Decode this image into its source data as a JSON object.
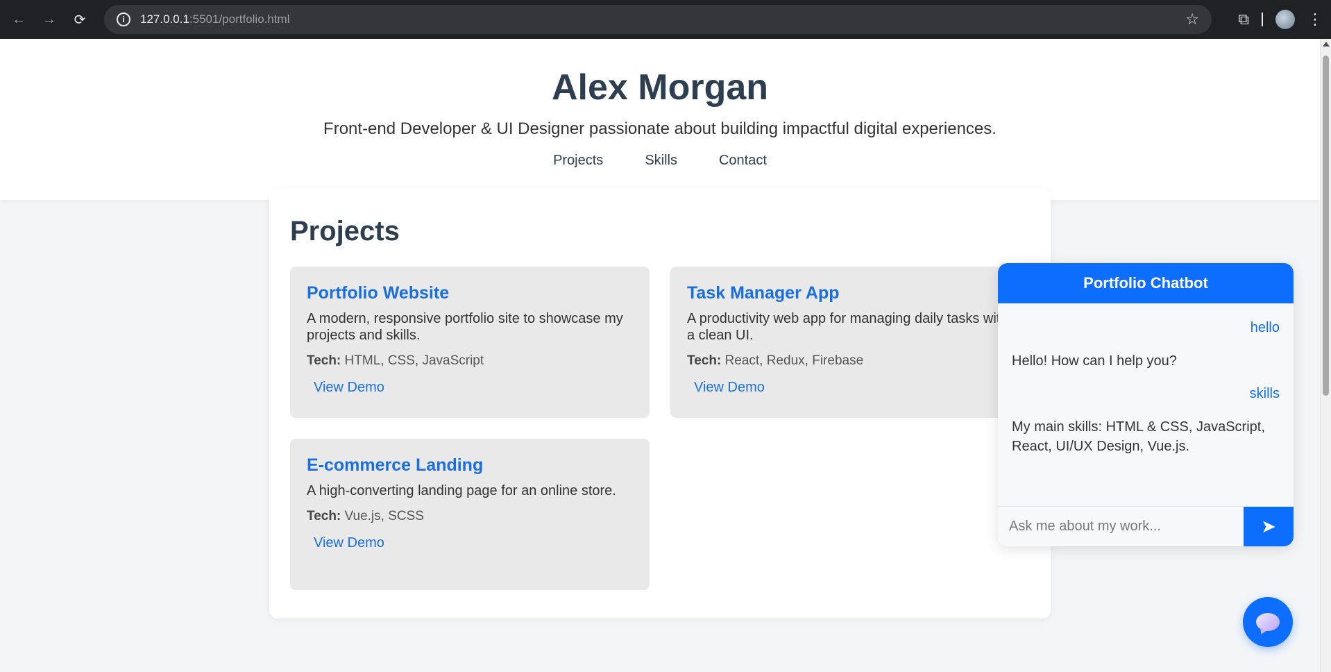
{
  "browser": {
    "url_host": "127.0.0.1",
    "url_path": ":5501/portfolio.html",
    "info_icon": "i"
  },
  "header": {
    "name": "Alex Morgan",
    "tagline": "Front-end Developer & UI Designer passionate about building impactful digital experiences.",
    "nav": [
      "Projects",
      "Skills",
      "Contact"
    ]
  },
  "projects": {
    "title": "Projects",
    "tech_label": "Tech:",
    "demo_label": "View Demo",
    "items": [
      {
        "title": "Portfolio Website",
        "description": "A modern, responsive portfolio site to showcase my projects and skills.",
        "tech": "HTML, CSS, JavaScript"
      },
      {
        "title": "Task Manager App",
        "description": "A productivity web app for managing daily tasks with a clean UI.",
        "tech": "React, Redux, Firebase"
      },
      {
        "title": "E-commerce Landing",
        "description": "A high-converting landing page for an online store.",
        "tech": "Vue.js, SCSS"
      }
    ]
  },
  "chatbot": {
    "title": "Portfolio Chatbot",
    "messages": [
      {
        "from": "user",
        "text": "hello"
      },
      {
        "from": "bot",
        "text": "Hello! How can I help you?"
      },
      {
        "from": "user",
        "text": "skills"
      },
      {
        "from": "bot",
        "text": "My main skills: HTML & CSS, JavaScript, React, UI/UX Design, Vue.js."
      }
    ],
    "input_placeholder": "Ask me about my work...",
    "send_icon": "➤"
  },
  "colors": {
    "accent": "#0d6efd",
    "link": "#1a6fe0",
    "heading": "#2c3e50",
    "card_bg": "#e9e9e9"
  }
}
